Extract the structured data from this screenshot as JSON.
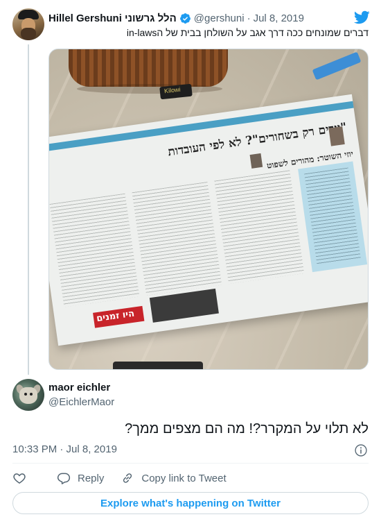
{
  "original_tweet": {
    "author_name": "Hillel Gershuni הלל גרשוני",
    "handle": "@gershuni",
    "separator": "·",
    "date": "Jul 8, 2019",
    "text": "דברים שמונחים ככה דרך אגב על השולחן בבית של הin-laws",
    "media": {
      "headline": "\"יורים רק בשחורים\"? לא לפי העובדות",
      "subheadline": "יוזי השוטר: מהורים לשפוט",
      "ad_text": "היו זמנים",
      "tag_text": "Kilowi"
    }
  },
  "reply": {
    "author_name": "maor eichler",
    "handle": "@EichlerMaor",
    "text": "לא תלוי על המקרר?! מה הם מצפים ממך?",
    "timestamp": "10:33 PM · Jul 8, 2019"
  },
  "actions": {
    "like_label": "",
    "reply_label": "Reply",
    "copy_link_label": "Copy link to Tweet"
  },
  "explore_label": "Explore what's happening on Twitter",
  "colors": {
    "twitter_blue": "#1d9bf0",
    "text_primary": "#0f1419",
    "text_secondary": "#536471",
    "border": "#cfd9de"
  },
  "icons": [
    "verified-badge-icon",
    "twitter-bird-icon",
    "info-icon",
    "heart-icon",
    "reply-icon",
    "link-icon"
  ]
}
